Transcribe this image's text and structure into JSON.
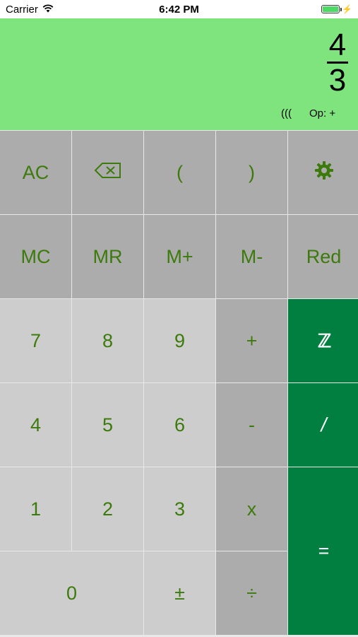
{
  "status_bar": {
    "carrier": "Carrier",
    "time": "6:42 PM",
    "wifi_icon": "wifi-icon",
    "battery_icon": "battery-icon",
    "charging_icon": "charging-bolt-icon",
    "battery_level": 1.0
  },
  "display": {
    "numerator": "4",
    "denominator": "3",
    "paren_indicator": "(((",
    "op_indicator": "Op: +"
  },
  "keys": {
    "ac": "AC",
    "backspace_icon": "backspace-icon",
    "lparen": "(",
    "rparen": ")",
    "settings_icon": "gear-icon",
    "mc": "MC",
    "mr": "MR",
    "mplus": "M+",
    "mminus": "M-",
    "red": "Red",
    "seven": "7",
    "eight": "8",
    "nine": "9",
    "plus": "+",
    "integer": "ℤ",
    "four": "4",
    "five": "5",
    "six": "6",
    "minus": "-",
    "fraction_slash": "/",
    "one": "1",
    "two": "2",
    "three": "3",
    "multiply": "x",
    "equals": "=",
    "zero": "0",
    "plus_minus": "±",
    "divide": "÷"
  },
  "colors": {
    "display_bg": "#80e47e",
    "key_text": "#3d7a0c",
    "function_key_bg": "#acacac",
    "digit_key_bg": "#cdcdcd",
    "action_key_bg": "#007f40"
  }
}
